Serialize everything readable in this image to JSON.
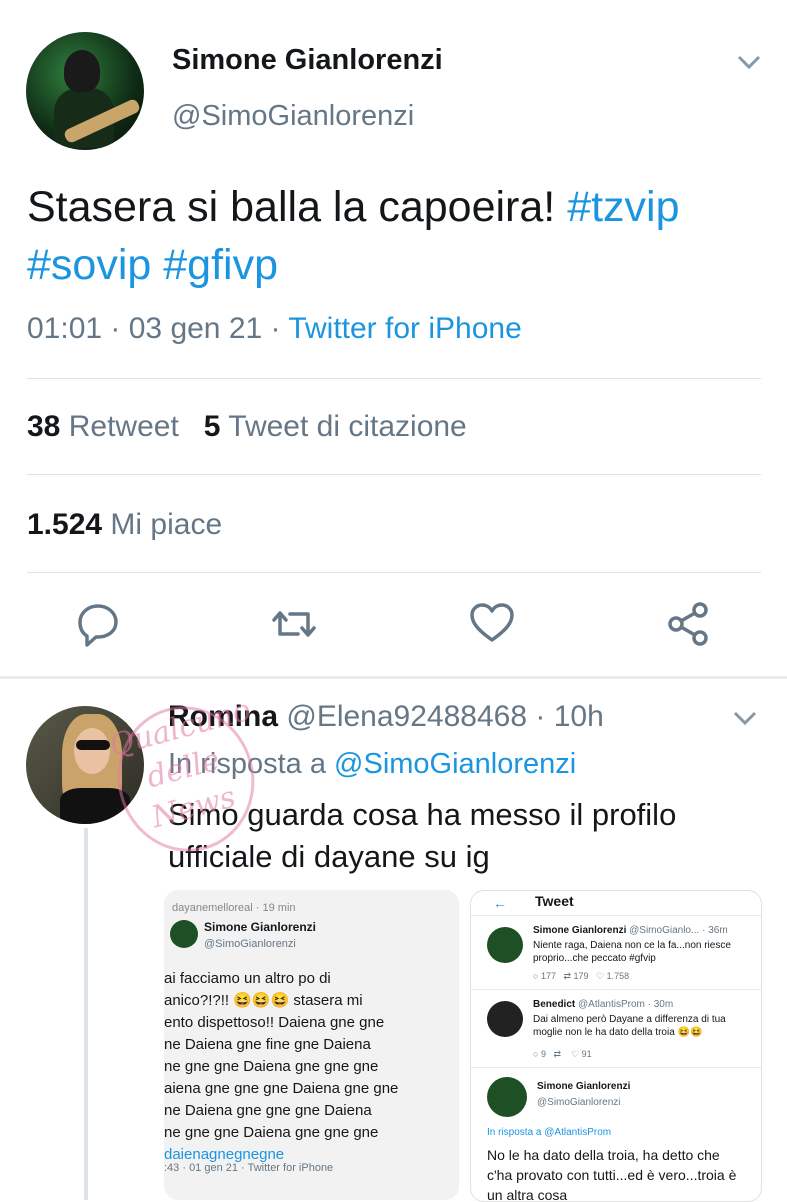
{
  "tweet": {
    "author_name": "Simone Gianlorenzi",
    "author_handle": "@SimoGianlorenzi",
    "text_main": "Stasera si balla la capoeira! ",
    "hashtag1": "#tzvip",
    "hashtag2": "#sovip",
    "hashtag3": "#gfivp",
    "time": "01:01 · 03 gen 21 · ",
    "source": "Twitter for iPhone",
    "retweets_count": "38",
    "retweets_label": "Retweet",
    "quotes_count": "5",
    "quotes_label": "Tweet di citazione",
    "likes_count": "1.524",
    "likes_label": "Mi piace"
  },
  "reply": {
    "name": "Romina",
    "handle": "@Elena92488468",
    "time": "· 10h",
    "in_reply_prefix": "In risposta a ",
    "in_reply_handle": "@SimoGianlorenzi",
    "text": "Simo guarda cosa ha messo il profilo ufficiale di dayane su ig",
    "watermark": "Qualcuno delle News"
  },
  "media1": {
    "header": "dayanemelloreal · 19 min",
    "name": "Simone Gianlorenzi",
    "handle": "@SimoGianlorenzi",
    "lines": [
      "ai facciamo un altro po di",
      "anico?!?!! 😆😆😆 stasera mi",
      "ento dispettoso!! Daiena gne gne",
      "ne Daiena gne fine gne Daiena",
      "ne gne gne Daiena gne gne gne",
      "aiena gne gne gne Daiena gne gne",
      "ne Daiena gne gne gne Daiena",
      "ne gne gne Daiena gne gne gne"
    ],
    "hashtag": "daienagnegnegne",
    "footer": ":43 · 01 gen 21 · Twitter for iPhone"
  },
  "media2": {
    "title": "Tweet",
    "t1_name": "Simone Gianlorenzi",
    "t1_meta": "@SimoGianlo... · 36m",
    "t1_text": "Niente raga, Daiena non ce la fa...non riesce proprio...che peccato #gfvip",
    "t1_stats": [
      "177",
      "179",
      "1.758"
    ],
    "t2_name": "Benedict",
    "t2_meta": "@AtlantisProm · 30m",
    "t2_text": "Dai almeno però Dayane a differenza di tua moglie non le ha dato della troia 😆😆",
    "t2_stats": [
      "9",
      "",
      "91"
    ],
    "t3_name": "Simone Gianlorenzi",
    "t3_handle": "@SimoGianlorenzi",
    "t3_reply": "In risposta a @AtlantisProm",
    "t3_text": "No le ha dato della troia, ha detto che c'ha provato con tutti...ed è vero...troia è un altra cosa"
  },
  "colors": {
    "link": "#1b95e0",
    "muted": "#657786",
    "text": "#14171a"
  }
}
